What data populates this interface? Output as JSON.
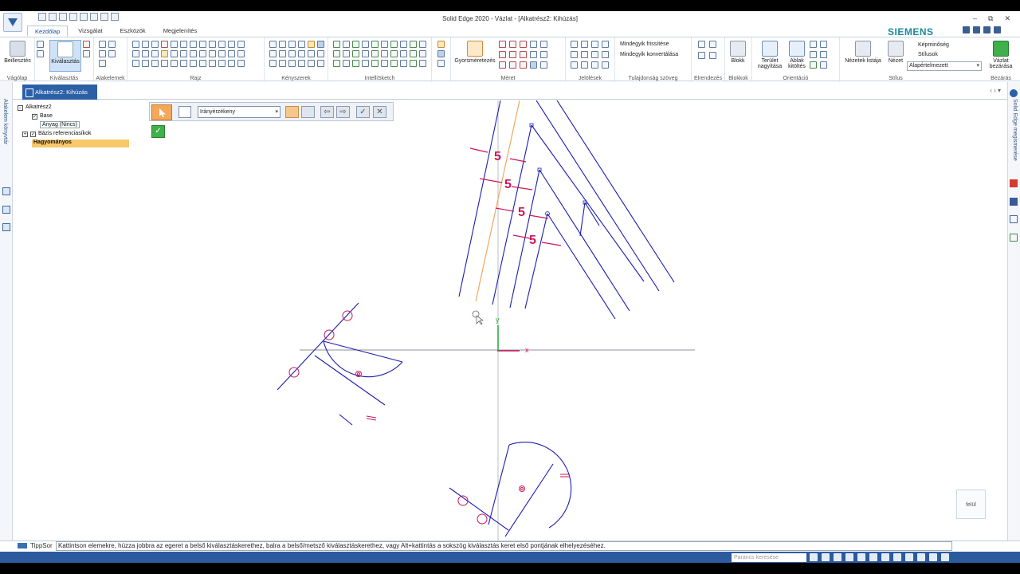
{
  "window": {
    "title": "Solid Edge 2020 - Vázlat - [Alkatrész2: Kihúzás]",
    "ctrl_min": "–",
    "ctrl_restore": "⧉",
    "ctrl_close": "✕"
  },
  "brand": "SIEMENS",
  "ribbon_tabs": [
    "Kezdőlap",
    "Vizsgálat",
    "Eszközök",
    "Megjelenítés"
  ],
  "ribbon": {
    "paste": "Beillesztés",
    "select": "Kiválasztás",
    "smart_dim": "Gyorsméretezés",
    "select_all": "Mindegyik frissítése",
    "convert_all": "Mindegyik konvertálása",
    "block": "Blokk",
    "zoom_area": "Terület nagyítása",
    "fit": "Ablak kitöltés",
    "named_views": "Nézetek listája",
    "view": "Nézet",
    "quality": "Képminőség",
    "styles": "Stílusok",
    "style_value": "Alapértelmezett",
    "close_sketch": "Vázlat bezárása",
    "groups": {
      "clipboard": "Vágólap",
      "select": "Kiválasztás",
      "elements": "Alakelemek",
      "draw": "Rajz",
      "relate": "Kényszerek",
      "intellisketch": "IntelliSketch",
      "dimension": "Méret",
      "annotation": "Jelölések",
      "properties": "Tulajdonság szöveg",
      "arrange": "Elrendezés",
      "blocks": "Blokkok",
      "orient": "Orientáció",
      "style": "Stílus",
      "close": "Bezárás"
    }
  },
  "document_tab": "Alkatrész2: Kihúzás",
  "left_panel_label": "Alakelem könyvtár",
  "right_panel_label": "Solid Edge megismerése",
  "tree": {
    "root": "Alkatrész2",
    "base": "Base",
    "material": "Anyag (Nincs)",
    "ref_planes": "Bázis referenciasíkok",
    "ordered": "Hagyományos"
  },
  "command_bar": {
    "filter": "Irányérzékeny"
  },
  "dimension_values": [
    "5",
    "5",
    "5",
    "5"
  ],
  "viewcube_label": "felül",
  "axis_x": "x",
  "axis_y": "y",
  "status": {
    "tipsor": "TippSor",
    "prompt": "Kattintson elemekre, húzza jobbra az egeret a belső kiválasztáskerethez, balra a belső/metsző kiválasztáskerethez, vagy Alt+kattintás a sokszög kiválasztás keret első pontjának elhelyezéséhez."
  },
  "command_search_placeholder": "Parancs keresése",
  "colors": {
    "sketch_blue": "#1c1cb0",
    "dimension_magenta": "#c8185a",
    "reference_orange": "#f0a860",
    "highlight": "#f8c86a",
    "accent": "#2b5fa6"
  }
}
